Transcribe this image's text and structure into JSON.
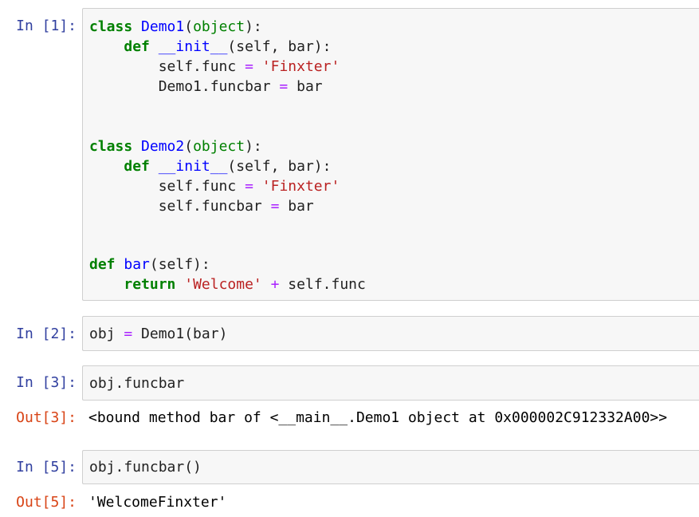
{
  "cells": [
    {
      "prompt": "In [1]:",
      "lines": [
        [
          [
            "kw",
            "class"
          ],
          [
            "t",
            " "
          ],
          [
            "def",
            "Demo1"
          ],
          [
            "t",
            "("
          ],
          [
            "bi",
            "object"
          ],
          [
            "t",
            "):"
          ]
        ],
        [
          [
            "t",
            "    "
          ],
          [
            "kw",
            "def"
          ],
          [
            "t",
            " "
          ],
          [
            "def",
            "__init__"
          ],
          [
            "t",
            "(self, bar):"
          ]
        ],
        [
          [
            "t",
            "        self.func "
          ],
          [
            "op",
            "="
          ],
          [
            "t",
            " "
          ],
          [
            "str",
            "'Finxter'"
          ]
        ],
        [
          [
            "t",
            "        Demo1.funcbar "
          ],
          [
            "op",
            "="
          ],
          [
            "t",
            " bar"
          ]
        ],
        [
          [
            "t",
            ""
          ]
        ],
        [
          [
            "t",
            ""
          ]
        ],
        [
          [
            "kw",
            "class"
          ],
          [
            "t",
            " "
          ],
          [
            "def",
            "Demo2"
          ],
          [
            "t",
            "("
          ],
          [
            "bi",
            "object"
          ],
          [
            "t",
            "):"
          ]
        ],
        [
          [
            "t",
            "    "
          ],
          [
            "kw",
            "def"
          ],
          [
            "t",
            " "
          ],
          [
            "def",
            "__init__"
          ],
          [
            "t",
            "(self, bar):"
          ]
        ],
        [
          [
            "t",
            "        self.func "
          ],
          [
            "op",
            "="
          ],
          [
            "t",
            " "
          ],
          [
            "str",
            "'Finxter'"
          ]
        ],
        [
          [
            "t",
            "        self.funcbar "
          ],
          [
            "op",
            "="
          ],
          [
            "t",
            " bar"
          ]
        ],
        [
          [
            "t",
            ""
          ]
        ],
        [
          [
            "t",
            ""
          ]
        ],
        [
          [
            "kw",
            "def"
          ],
          [
            "t",
            " "
          ],
          [
            "def",
            "bar"
          ],
          [
            "t",
            "(self):"
          ]
        ],
        [
          [
            "t",
            "    "
          ],
          [
            "kw",
            "return"
          ],
          [
            "t",
            " "
          ],
          [
            "str",
            "'Welcome'"
          ],
          [
            "t",
            " "
          ],
          [
            "op",
            "+"
          ],
          [
            "t",
            " self.func"
          ]
        ]
      ]
    },
    {
      "prompt": "In [2]:",
      "lines": [
        [
          [
            "t",
            "obj "
          ],
          [
            "op",
            "="
          ],
          [
            "t",
            " Demo1(bar)"
          ]
        ]
      ]
    },
    {
      "prompt": "In [3]:",
      "lines": [
        [
          [
            "t",
            "obj.funcbar"
          ]
        ]
      ],
      "out_prompt": "Out[3]:",
      "output": "<bound method bar of <__main__.Demo1 object at 0x000002C912332A00>>"
    },
    {
      "prompt": "In [5]:",
      "lines": [
        [
          [
            "t",
            "obj.funcbar()"
          ]
        ]
      ],
      "out_prompt": "Out[5]:",
      "output": "'WelcomeFinxter'"
    }
  ]
}
